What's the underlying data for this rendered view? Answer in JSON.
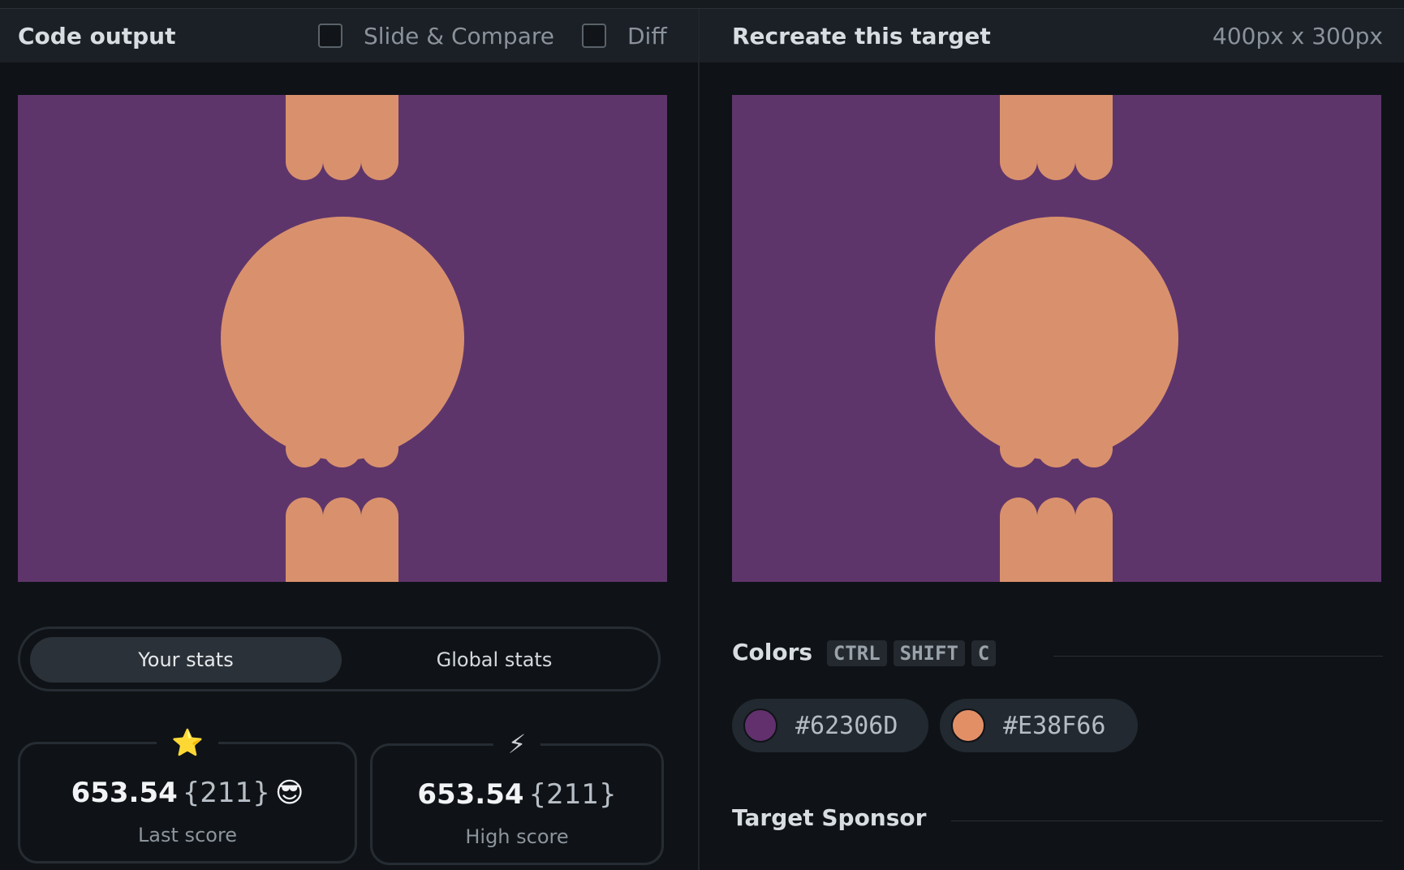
{
  "left_panel": {
    "title": "Code output",
    "slide_compare_label": "Slide & Compare",
    "diff_label": "Diff"
  },
  "right_panel": {
    "title": "Recreate this target",
    "dimensions": "400px x 300px"
  },
  "stats": {
    "tabs": [
      "Your stats",
      "Global stats"
    ],
    "last_score": {
      "icon": "star-icon",
      "value": "653.54",
      "count": "{211}",
      "label": "Last score"
    },
    "high_score": {
      "icon": "lightning-icon",
      "value": "653.54",
      "count": "{211}",
      "label": "High score"
    }
  },
  "colors_section": {
    "title": "Colors",
    "shortcut_keys": [
      "CTRL",
      "SHIFT",
      "C"
    ],
    "swatches": [
      "#62306D",
      "#E38F66"
    ]
  },
  "sponsor_section": {
    "title": "Target Sponsor"
  },
  "theme": {
    "canvas_bg": "#5e356b",
    "shape_fill": "#d9916d"
  }
}
